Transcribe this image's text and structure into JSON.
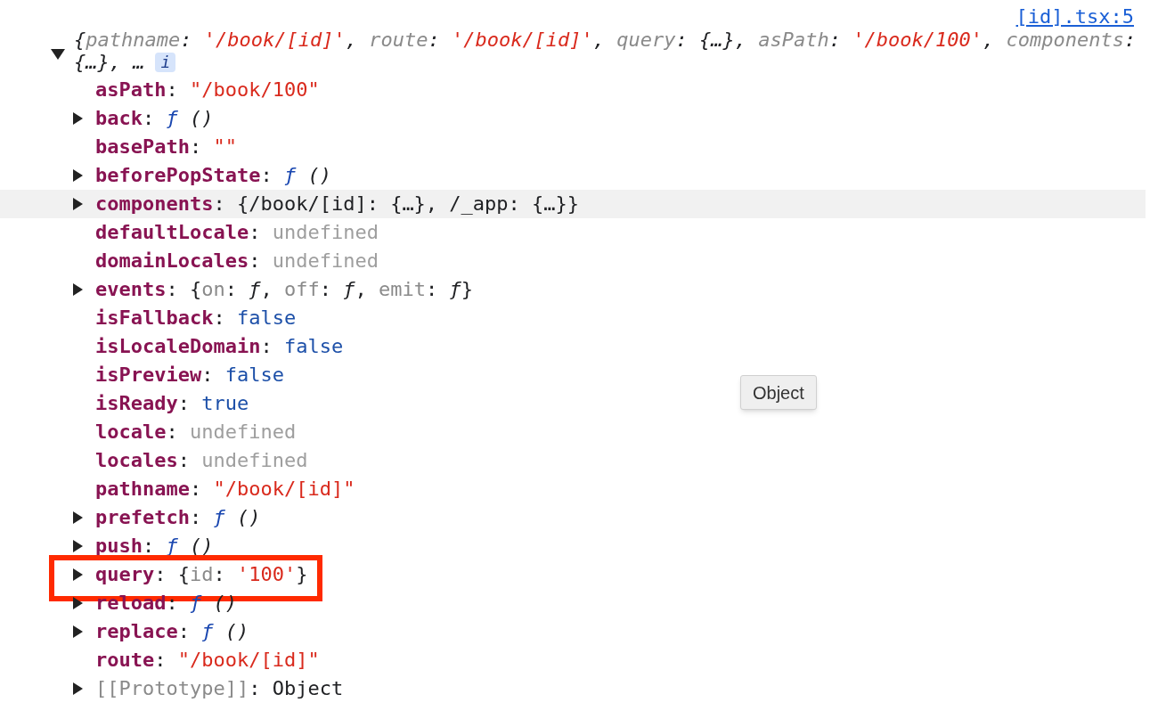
{
  "source_link": "[id].tsx:5",
  "summary": {
    "expanded": true,
    "lines": [
      [
        {
          "kind": "punct",
          "text": "{"
        },
        {
          "kind": "key",
          "text": "pathname"
        },
        {
          "kind": "punct",
          "text": ": "
        },
        {
          "kind": "string",
          "text": "'/book/[id]'"
        },
        {
          "kind": "punct",
          "text": ", "
        },
        {
          "kind": "key",
          "text": "route"
        },
        {
          "kind": "punct",
          "text": ": "
        },
        {
          "kind": "string",
          "text": "'/book/[id]'"
        },
        {
          "kind": "punct",
          "text": ", "
        },
        {
          "kind": "key",
          "text": "query"
        },
        {
          "kind": "punct",
          "text": ": {…}, "
        },
        {
          "kind": "key",
          "text": "asPath"
        },
        {
          "kind": "punct",
          "text": ": "
        },
        {
          "kind": "string",
          "text": "'/book/100'"
        },
        {
          "kind": "punct",
          "text": ", "
        },
        {
          "kind": "key",
          "text": "components"
        },
        {
          "kind": "punct",
          "text": ":"
        }
      ],
      [
        {
          "kind": "punct",
          "text": "{…}, …"
        }
      ]
    ],
    "badge": "i"
  },
  "rows": [
    {
      "key": "asPath",
      "kind": "property",
      "expandable": false,
      "highlighted": false,
      "boxed": false,
      "value": [
        {
          "kind": "punct",
          "text": ": "
        },
        {
          "kind": "string",
          "text": "\"/book/100\""
        }
      ]
    },
    {
      "key": "back",
      "kind": "property",
      "expandable": true,
      "highlighted": false,
      "boxed": false,
      "value": [
        {
          "kind": "punct",
          "text": ": "
        },
        {
          "kind": "fn",
          "text": "ƒ"
        },
        {
          "kind": "italic",
          "text": " ()"
        }
      ]
    },
    {
      "key": "basePath",
      "kind": "property",
      "expandable": false,
      "highlighted": false,
      "boxed": false,
      "value": [
        {
          "kind": "punct",
          "text": ": "
        },
        {
          "kind": "string",
          "text": "\"\""
        }
      ]
    },
    {
      "key": "beforePopState",
      "kind": "property",
      "expandable": true,
      "highlighted": false,
      "boxed": false,
      "value": [
        {
          "kind": "punct",
          "text": ": "
        },
        {
          "kind": "fn",
          "text": "ƒ"
        },
        {
          "kind": "italic",
          "text": " ()"
        }
      ]
    },
    {
      "key": "components",
      "kind": "property",
      "expandable": true,
      "highlighted": true,
      "boxed": false,
      "value": [
        {
          "kind": "punct",
          "text": ": {/book/[id]: {…}, /_app: {…}}"
        }
      ]
    },
    {
      "key": "defaultLocale",
      "kind": "property",
      "expandable": false,
      "highlighted": false,
      "boxed": false,
      "value": [
        {
          "kind": "punct",
          "text": ": "
        },
        {
          "kind": "undefined",
          "text": "undefined"
        }
      ]
    },
    {
      "key": "domainLocales",
      "kind": "property",
      "expandable": false,
      "highlighted": false,
      "boxed": false,
      "value": [
        {
          "kind": "punct",
          "text": ": "
        },
        {
          "kind": "undefined",
          "text": "undefined"
        }
      ]
    },
    {
      "key": "events",
      "kind": "property",
      "expandable": true,
      "highlighted": false,
      "boxed": false,
      "value": [
        {
          "kind": "punct",
          "text": ": {"
        },
        {
          "kind": "key",
          "text": "on"
        },
        {
          "kind": "punct",
          "text": ": "
        },
        {
          "kind": "italic",
          "text": "ƒ"
        },
        {
          "kind": "punct",
          "text": ", "
        },
        {
          "kind": "key",
          "text": "off"
        },
        {
          "kind": "punct",
          "text": ": "
        },
        {
          "kind": "italic",
          "text": "ƒ"
        },
        {
          "kind": "punct",
          "text": ", "
        },
        {
          "kind": "key",
          "text": "emit"
        },
        {
          "kind": "punct",
          "text": ": "
        },
        {
          "kind": "italic",
          "text": "ƒ"
        },
        {
          "kind": "punct",
          "text": "}"
        }
      ]
    },
    {
      "key": "isFallback",
      "kind": "property",
      "expandable": false,
      "highlighted": false,
      "boxed": false,
      "value": [
        {
          "kind": "punct",
          "text": ": "
        },
        {
          "kind": "bool",
          "text": "false"
        }
      ]
    },
    {
      "key": "isLocaleDomain",
      "kind": "property",
      "expandable": false,
      "highlighted": false,
      "boxed": false,
      "value": [
        {
          "kind": "punct",
          "text": ": "
        },
        {
          "kind": "bool",
          "text": "false"
        }
      ]
    },
    {
      "key": "isPreview",
      "kind": "property",
      "expandable": false,
      "highlighted": false,
      "boxed": false,
      "value": [
        {
          "kind": "punct",
          "text": ": "
        },
        {
          "kind": "bool",
          "text": "false"
        }
      ]
    },
    {
      "key": "isReady",
      "kind": "property",
      "expandable": false,
      "highlighted": false,
      "boxed": false,
      "value": [
        {
          "kind": "punct",
          "text": ": "
        },
        {
          "kind": "bool",
          "text": "true"
        }
      ]
    },
    {
      "key": "locale",
      "kind": "property",
      "expandable": false,
      "highlighted": false,
      "boxed": false,
      "value": [
        {
          "kind": "punct",
          "text": ": "
        },
        {
          "kind": "undefined",
          "text": "undefined"
        }
      ]
    },
    {
      "key": "locales",
      "kind": "property",
      "expandable": false,
      "highlighted": false,
      "boxed": false,
      "value": [
        {
          "kind": "punct",
          "text": ": "
        },
        {
          "kind": "undefined",
          "text": "undefined"
        }
      ]
    },
    {
      "key": "pathname",
      "kind": "property",
      "expandable": false,
      "highlighted": false,
      "boxed": false,
      "value": [
        {
          "kind": "punct",
          "text": ": "
        },
        {
          "kind": "string",
          "text": "\"/book/[id]\""
        }
      ]
    },
    {
      "key": "prefetch",
      "kind": "property",
      "expandable": true,
      "highlighted": false,
      "boxed": false,
      "value": [
        {
          "kind": "punct",
          "text": ": "
        },
        {
          "kind": "fn",
          "text": "ƒ"
        },
        {
          "kind": "italic",
          "text": " ()"
        }
      ]
    },
    {
      "key": "push",
      "kind": "property",
      "expandable": true,
      "highlighted": false,
      "boxed": false,
      "value": [
        {
          "kind": "punct",
          "text": ": "
        },
        {
          "kind": "fn",
          "text": "ƒ"
        },
        {
          "kind": "italic",
          "text": " ()"
        }
      ]
    },
    {
      "key": "query",
      "kind": "property",
      "expandable": true,
      "highlighted": false,
      "boxed": true,
      "value": [
        {
          "kind": "punct",
          "text": ": {"
        },
        {
          "kind": "key",
          "text": "id"
        },
        {
          "kind": "punct",
          "text": ": "
        },
        {
          "kind": "string",
          "text": "'100'"
        },
        {
          "kind": "punct",
          "text": "}"
        }
      ]
    },
    {
      "key": "reload",
      "kind": "property",
      "expandable": true,
      "highlighted": false,
      "boxed": false,
      "value": [
        {
          "kind": "punct",
          "text": ": "
        },
        {
          "kind": "fn",
          "text": "ƒ"
        },
        {
          "kind": "italic",
          "text": " ()"
        }
      ]
    },
    {
      "key": "replace",
      "kind": "property",
      "expandable": true,
      "highlighted": false,
      "boxed": false,
      "value": [
        {
          "kind": "punct",
          "text": ": "
        },
        {
          "kind": "fn",
          "text": "ƒ"
        },
        {
          "kind": "italic",
          "text": " ()"
        }
      ]
    },
    {
      "key": "route",
      "kind": "property",
      "expandable": false,
      "highlighted": false,
      "boxed": false,
      "value": [
        {
          "kind": "punct",
          "text": ": "
        },
        {
          "kind": "string",
          "text": "\"/book/[id]\""
        }
      ]
    },
    {
      "key": "[[Prototype]]",
      "kind": "internal",
      "expandable": true,
      "highlighted": false,
      "boxed": false,
      "value": [
        {
          "kind": "punct",
          "text": ": Object"
        }
      ]
    }
  ],
  "tooltip": "Object"
}
